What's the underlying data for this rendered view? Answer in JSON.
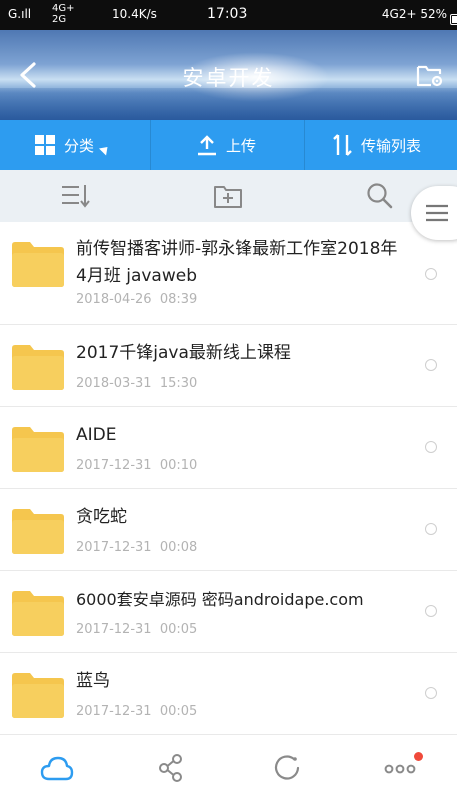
{
  "status_bar": {
    "signal_left": "G.ıll",
    "network_top": "4G+",
    "network_bottom": "2G",
    "speed": "10.4K/s",
    "time": "17:03",
    "right": "4G2+ 52%",
    "battery_percent": 52
  },
  "header": {
    "title": "安卓开发",
    "back_icon": "chevron-left-icon",
    "settings_icon": "folder-settings-icon"
  },
  "action_bar": {
    "category_label": "分类",
    "upload_label": "上传",
    "transfer_label": "传输列表",
    "background": "#2d9cf0"
  },
  "toolbar": {
    "sort_icon": "sort-icon",
    "new_folder_icon": "new-folder-icon",
    "search_icon": "search-icon",
    "menu_icon": "hamburger-menu-icon"
  },
  "files": [
    {
      "name": "前传智播客讲师-郭永锋最新工作室2018年4月班 javaweb",
      "date": "2018-04-26  08:39"
    },
    {
      "name": "2017千锋java最新线上课程",
      "date": "2018-03-31  15:30"
    },
    {
      "name": "AIDE",
      "date": "2017-12-31  00:10"
    },
    {
      "name": "贪吃蛇",
      "date": "2017-12-31  00:08"
    },
    {
      "name": "6000套安卓源码 密码androidape.com",
      "date": "2017-12-31  00:05"
    },
    {
      "name": "蓝鸟",
      "date": "2017-12-31  00:05"
    }
  ],
  "bottom_nav": {
    "items": [
      "cloud-icon",
      "share-icon",
      "sync-icon",
      "more-icon"
    ],
    "accent": "#2d9cf0",
    "badge_color": "#f04a3b"
  }
}
